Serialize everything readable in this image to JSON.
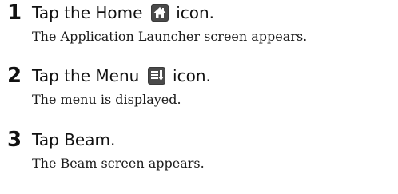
{
  "steps": [
    {
      "number": "1",
      "instruction_before": "Tap the Home",
      "icon": "home-icon",
      "instruction_after": "icon.",
      "result": "The Application Launcher screen appears."
    },
    {
      "number": "2",
      "instruction_before": "Tap the Menu",
      "icon": "menu-icon",
      "instruction_after": "icon.",
      "result": "The menu is displayed."
    },
    {
      "number": "3",
      "instruction": "Tap Beam.",
      "result": "The Beam screen appears."
    }
  ],
  "colors": {
    "icon_tile": "#3a3a3a",
    "icon_glyph": "#ffffff",
    "text": "#111111"
  }
}
